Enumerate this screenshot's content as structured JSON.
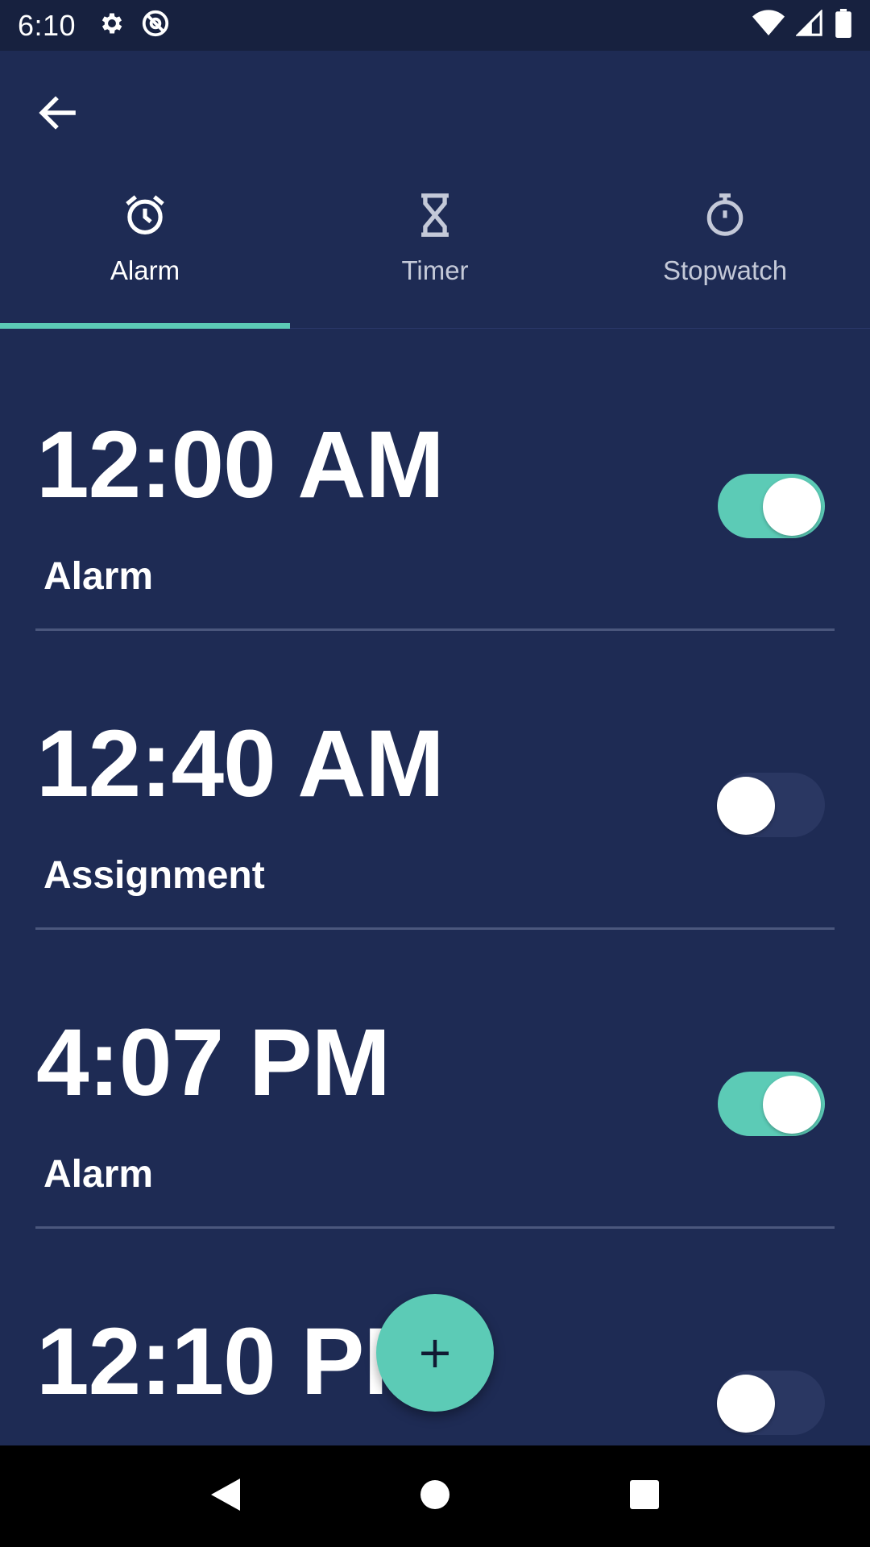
{
  "status_bar": {
    "time": "6:10",
    "left_icons": [
      "gear-icon",
      "at-sync-icon"
    ],
    "right_icons": [
      "wifi-icon",
      "signal-icon",
      "battery-icon"
    ]
  },
  "app_bar": {
    "back_icon": "arrow-left-icon",
    "tabs": [
      {
        "label": "Alarm",
        "icon": "alarm-clock-icon",
        "active": true
      },
      {
        "label": "Timer",
        "icon": "hourglass-icon",
        "active": false
      },
      {
        "label": "Stopwatch",
        "icon": "stopwatch-icon",
        "active": false
      }
    ]
  },
  "alarms": [
    {
      "time": "12:00 AM",
      "label": "Alarm",
      "enabled": true
    },
    {
      "time": "12:40 AM",
      "label": "Assignment",
      "enabled": false
    },
    {
      "time": "4:07 PM",
      "label": "Alarm",
      "enabled": true
    },
    {
      "time": "12:10 PM",
      "label": "",
      "enabled": false
    }
  ],
  "fab": {
    "label": "+",
    "icon": "plus-icon"
  },
  "nav_bar": {
    "buttons": [
      "back-triangle-icon",
      "home-circle-icon",
      "recents-square-icon"
    ]
  },
  "colors": {
    "background": "#1e2b54",
    "status_bar": "#17213f",
    "accent": "#5ccbb6",
    "toggle_off_track": "#2a3762",
    "divider": "#4b577d"
  }
}
